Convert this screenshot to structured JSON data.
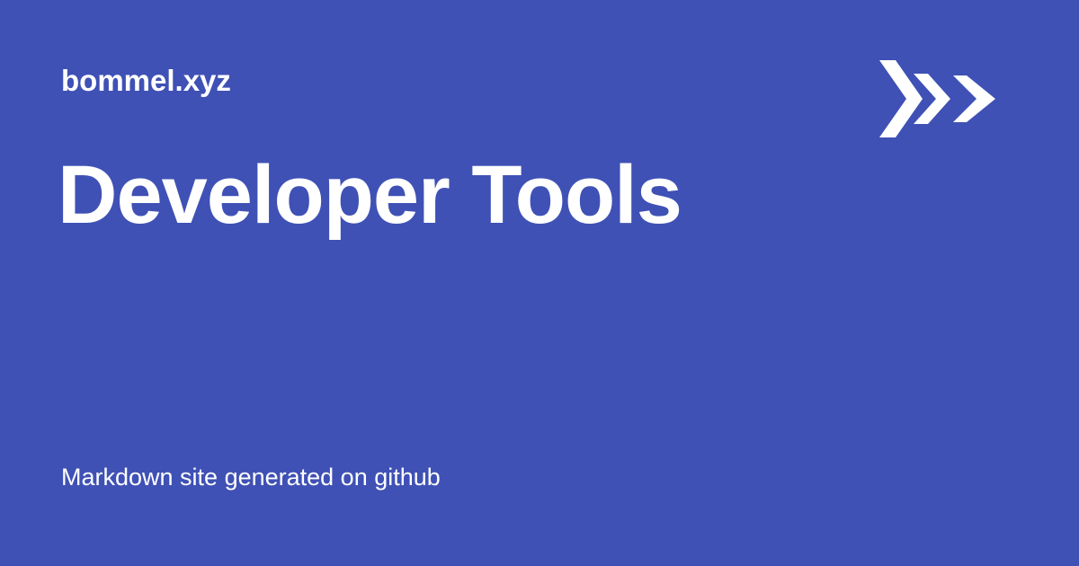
{
  "header": {
    "site_name": "bommel.xyz",
    "logo_icon": "triple-chevron-right-icon"
  },
  "main": {
    "title": "Developer Tools"
  },
  "footer": {
    "note": "Markdown site generated on github"
  },
  "colors": {
    "background": "#3f51b5",
    "text": "#ffffff"
  }
}
